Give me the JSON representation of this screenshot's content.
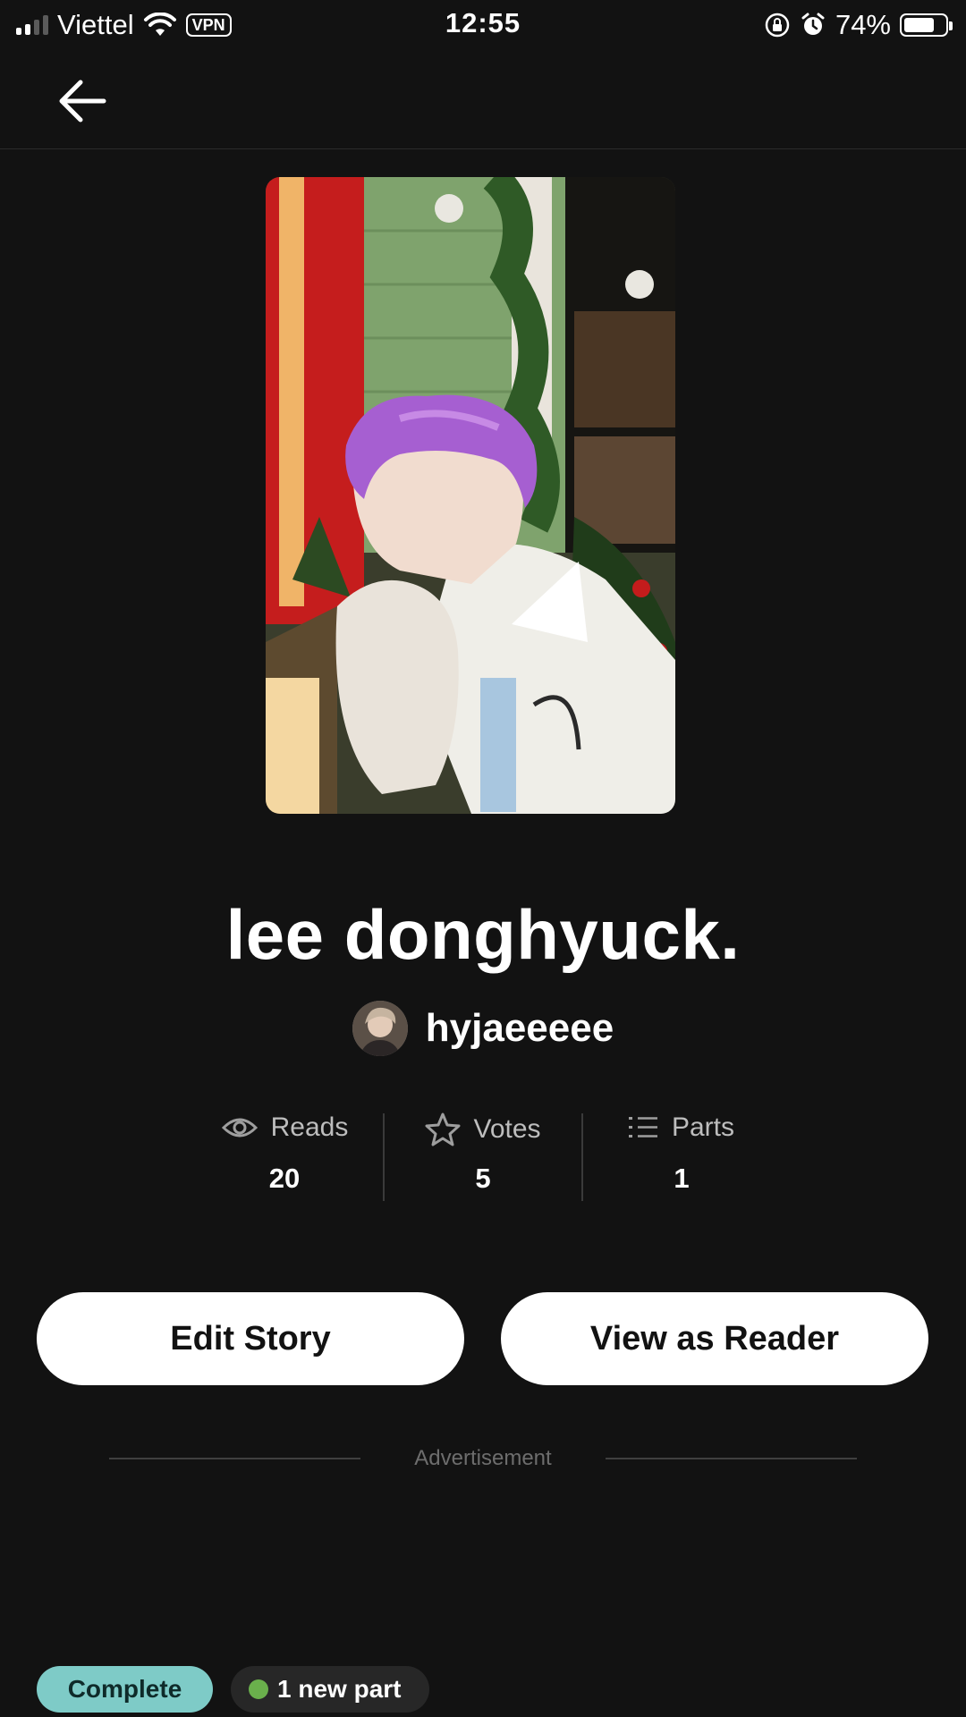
{
  "status_bar": {
    "carrier": "Viettel",
    "vpn": "VPN",
    "time": "12:55",
    "battery_percent": "74%",
    "battery_level": 0.74
  },
  "story": {
    "title": "lee donghyuck.",
    "author": "hyjaeeeee"
  },
  "stats": [
    {
      "label": "Reads",
      "value": "20",
      "icon": "eye-icon"
    },
    {
      "label": "Votes",
      "value": "5",
      "icon": "star-icon"
    },
    {
      "label": "Parts",
      "value": "1",
      "icon": "list-icon"
    }
  ],
  "actions": {
    "edit": "Edit Story",
    "view": "View as Reader"
  },
  "advertisement": "Advertisement",
  "tags": {
    "complete": "Complete",
    "new_part": "1 new part"
  },
  "colors": {
    "background": "#121212",
    "complete_tag": "#7ecbc7",
    "new_part_dot": "#6ab04c"
  }
}
